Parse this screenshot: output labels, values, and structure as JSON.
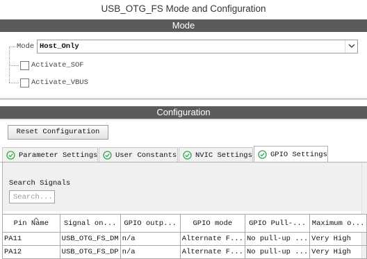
{
  "window": {
    "title": "USB_OTG_FS Mode and Configuration"
  },
  "mode_section": {
    "header": "Mode",
    "mode_label": "Mode",
    "mode_value": "Host_Only",
    "activate_sof_label": "Activate_SOF",
    "activate_sof_checked": false,
    "activate_vbus_label": "Activate_VBUS",
    "activate_vbus_checked": false
  },
  "config_section": {
    "header": "Configuration",
    "reset_label": "Reset Configuration",
    "tabs": [
      {
        "label": "Parameter Settings",
        "icon": "check-circle-icon",
        "active": false
      },
      {
        "label": "User Constants",
        "icon": "check-circle-icon",
        "active": false
      },
      {
        "label": "NVIC Settings",
        "icon": "check-circle-icon",
        "active": false
      },
      {
        "label": "GPIO Settings",
        "icon": "check-circle-icon",
        "active": true
      }
    ],
    "search": {
      "title": "Search Signals",
      "placeholder": "Search..."
    },
    "table": {
      "columns": [
        "Pin Name",
        "Signal on...",
        "GPIO outp...",
        "GPIO mode",
        "GPIO Pull-...",
        "Maximum o..."
      ],
      "rows": [
        [
          "PA11",
          "USB_OTG_FS_DM",
          "n/a",
          "Alternate F...",
          "No pull-up ...",
          "Very High"
        ],
        [
          "PA12",
          "USB_OTG_FS_DP",
          "n/a",
          "Alternate F...",
          "No pull-up ...",
          "Very High"
        ]
      ]
    }
  },
  "colors": {
    "section_bar": "#5b5b5b",
    "check_icon": "#3aa757"
  }
}
